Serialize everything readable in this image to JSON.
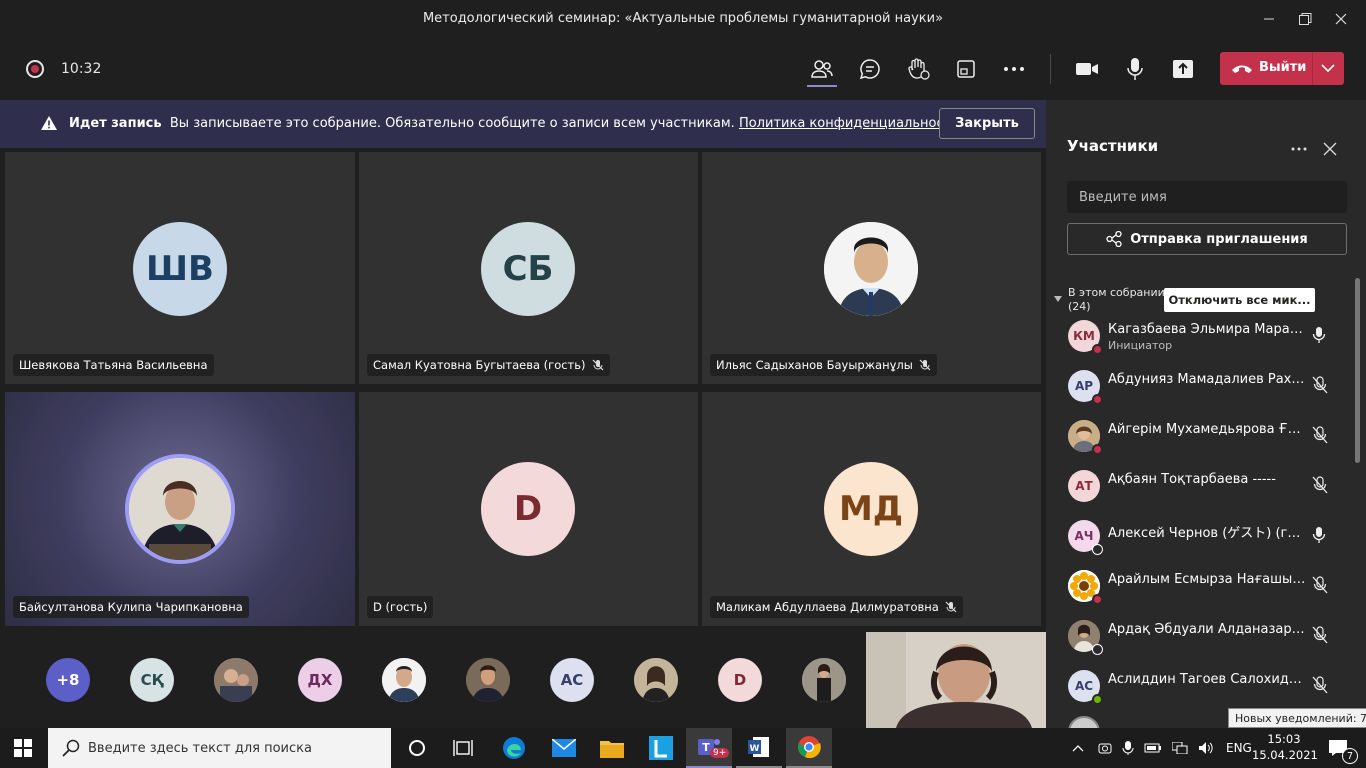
{
  "window": {
    "title": "Методологический семинар: «Актуальные проблемы гуманитарной науки»"
  },
  "toolbar": {
    "timer": "10:32",
    "leave_label": "Выйти"
  },
  "banner": {
    "heading": "Идет запись",
    "message": "Вы записываете это собрание. Обязательно сообщите о записи всем участникам.",
    "link": "Политика конфиденциальности",
    "close_label": "Закрыть"
  },
  "tiles": [
    {
      "initials": "ШВ",
      "name": "Шевякова Татьяна Васильевна",
      "muted": false
    },
    {
      "initials": "СБ",
      "name": "Самал Куатовна Бугытаева (гость)",
      "muted": true
    },
    {
      "initials": "",
      "name": "Ильяс Садыханов Бауыржанұлы",
      "muted": true
    },
    {
      "initials": "",
      "name": "Байсултанова Кулипа Чарипкановна",
      "muted": false
    },
    {
      "initials": "D",
      "name": "D (гость)",
      "muted": false
    },
    {
      "initials": "МД",
      "name": "Маликам Абдуллаева Дилмуратовна",
      "muted": true
    }
  ],
  "strip": {
    "more_count": "+8",
    "avatars": [
      "СҚ",
      "",
      "ДХ",
      "",
      "",
      "АС",
      "",
      "D",
      ""
    ]
  },
  "panel": {
    "title": "Участники",
    "search_placeholder": "Введите имя",
    "invite_label": "Отправка приглашения",
    "section_label": "В этом собрании",
    "section_count": "(24)",
    "mute_all_label": "Отключить все мик...",
    "participants": [
      {
        "initials": "КМ",
        "name": "Кагазбаева Эльмира Маратовна",
        "role": "Инициатор",
        "mic": "on"
      },
      {
        "initials": "АР",
        "name": "Абдунияз Мамадалиев Рахимович",
        "role": "",
        "mic": "off"
      },
      {
        "initials": "",
        "name": "Айгерім Мухамедьярова Ғалымжанқызы",
        "role": "",
        "mic": "off"
      },
      {
        "initials": "АТ",
        "name": "Ақбаян Тоқтарбаева -----",
        "role": "",
        "mic": "off"
      },
      {
        "initials": "АЧ",
        "name": "Алексей Чернов (ゲスト) (гость)",
        "role": "",
        "mic": "on"
      },
      {
        "initials": "",
        "name": "Арайлым Есмырза Нағашыбекқызы",
        "role": "",
        "mic": "off"
      },
      {
        "initials": "",
        "name": "Ардақ Әбдуали Алданазарқызы",
        "role": "",
        "mic": "off"
      },
      {
        "initials": "АС",
        "name": "Аслиддин Тагоев Салохиддинович",
        "role": "",
        "mic": "off"
      }
    ]
  },
  "taskbar": {
    "search_placeholder": "Введите здесь текст для поиска",
    "teams_badge": "9+",
    "language": "ENG",
    "time": "15:03",
    "date": "15.04.2021",
    "notif_count": "7",
    "notif_tooltip": "Новых уведомлений: 7"
  },
  "colors": {
    "leave": "#c4314b",
    "banner": "#2f2e4c",
    "panel": "#292929",
    "stage": "#201f1f"
  }
}
